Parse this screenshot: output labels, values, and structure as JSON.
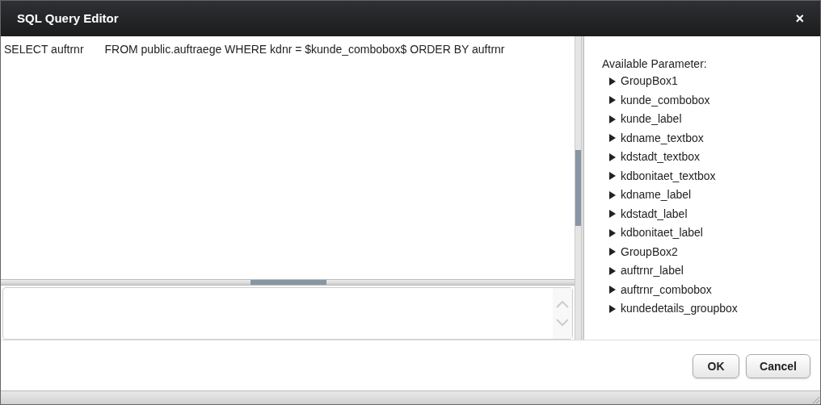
{
  "window": {
    "title": "SQL Query Editor",
    "close": "×"
  },
  "editor": {
    "query": "SELECT auftrnr\tFROM public.auftraege WHERE kdnr = $kunde_combobox$ ORDER BY auftrnr"
  },
  "parameters": {
    "heading": "Available Parameter:",
    "items": [
      {
        "label": "GroupBox1",
        "expanded": false
      },
      {
        "label": "kunde_combobox",
        "expanded": false
      },
      {
        "label": "kunde_label",
        "expanded": false
      },
      {
        "label": "kdname_textbox",
        "expanded": false
      },
      {
        "label": "kdstadt_textbox",
        "expanded": false
      },
      {
        "label": "kdbonitaet_textbox",
        "expanded": false
      },
      {
        "label": "kdname_label",
        "expanded": false
      },
      {
        "label": "kdstadt_label",
        "expanded": false
      },
      {
        "label": "kdbonitaet_label",
        "expanded": false
      },
      {
        "label": "GroupBox2",
        "expanded": false
      },
      {
        "label": "auftrnr_label",
        "expanded": false
      },
      {
        "label": "auftrnr_combobox",
        "expanded": false
      },
      {
        "label": "kundedetails_groupbox",
        "expanded": false
      }
    ]
  },
  "buttons": [
    "OK",
    "Cancel"
  ]
}
